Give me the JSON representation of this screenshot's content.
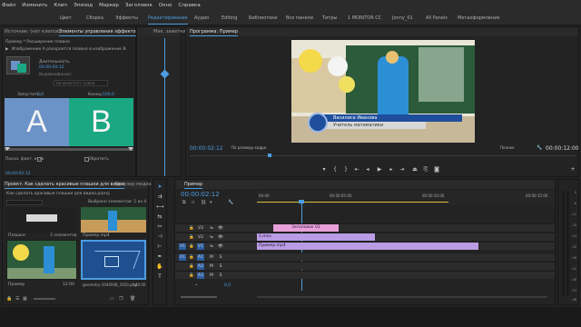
{
  "menu": [
    "Файл",
    "Изменить",
    "Клип",
    "Эпизод",
    "Маркер",
    "Заголовок",
    "Окно",
    "Справка"
  ],
  "workspaces": [
    {
      "label": "Цвет",
      "active": false
    },
    {
      "label": "Сборка",
      "active": false
    },
    {
      "label": "Эффекты",
      "active": false
    },
    {
      "label": "Редактирование",
      "active": true
    },
    {
      "label": "Аудио",
      "active": false
    },
    {
      "label": "Editing",
      "active": false
    },
    {
      "label": "Библиотеки",
      "active": false
    },
    {
      "label": "Все панели",
      "active": false
    },
    {
      "label": "Титры",
      "active": false
    },
    {
      "label": "1 MONITOR CC",
      "active": false
    },
    {
      "label": "Jonny_01",
      "active": false
    },
    {
      "label": "All Panels",
      "active": false
    },
    {
      "label": "Метаоформление",
      "active": false
    }
  ],
  "effects_panel": {
    "tabs": [
      "Источник: (нет клипов)",
      "Элементы управления эффектом",
      "Мик. заметки"
    ],
    "header": "Пример * Расширение плавно",
    "description": "Изображение A раскроется плавно в изображение B.",
    "duration_label": "Длительность",
    "duration_value": "00:00:00:12",
    "alignment_label": "Выравнивание:",
    "alignment_value": "Начинается с клипа",
    "start_label": "Запустить:",
    "start_value": "0,0",
    "end_label": "Конец:",
    "end_value": "100,0",
    "tile_a": "A",
    "tile_b": "B",
    "show_actual": "Показ. факт. исто",
    "reverse": "Обратить",
    "timecode": "00:00:02:12"
  },
  "program_monitor": {
    "title": "Программа: Пример",
    "lower_third_name": "Василиса Иванова",
    "lower_third_role": "Учитель математики",
    "timecode_left": "00:00:02:12",
    "fit": "По размеру кадра",
    "quality": "Полное",
    "timecode_right": "00:00:12:00"
  },
  "project_panel": {
    "tabs": [
      "Проект: Как сделать красивые плашки для видео",
      "Браузер медиа"
    ],
    "file": "Как сделать красивые плашки для видео.prproj",
    "selected": "Выбрано элементов: 1 из 4",
    "items": [
      {
        "name": "Плашки",
        "meta": "3 элементов"
      },
      {
        "name": "Пример.mp4",
        "meta": ""
      },
      {
        "name": "Пример",
        "meta": "12:00"
      },
      {
        "name": "geometry-1044048_1920.png",
        "meta": "1:40:00"
      }
    ]
  },
  "timeline": {
    "tab": "Пример",
    "timecode": "00:00:02:12",
    "ruler": [
      "00:00",
      "00:00:05:00",
      "00:00:10:00",
      "00:00:15:00"
    ],
    "track_labels": [
      "V3",
      "V2",
      "V1",
      "A1",
      "A2",
      "A3"
    ],
    "source_patch": [
      "V1",
      "A1"
    ],
    "clips": [
      {
        "label": "Заголовок 01",
        "track": "V3",
        "color": "#e7a0d8"
      },
      {
        "label": "1.mov",
        "track": "V2",
        "color": "#b99ce3"
      },
      {
        "label": "Пример.mp4",
        "track": "V1",
        "color": "#b99ce3"
      }
    ],
    "master_value": "0,0"
  },
  "vu_meter": {
    "ticks": [
      "0",
      "-6",
      "-12",
      "-18",
      "-24",
      "-30",
      "-36",
      "-42",
      "-48",
      "-54"
    ],
    "unit": "dB"
  },
  "colors": {
    "accent": "#4d9de0",
    "tile_a": "#6c93c8",
    "tile_b": "#1aa782",
    "clip_title": "#e7a0d8",
    "clip_video": "#b99ce3",
    "lower_third": "#1e4e9c"
  }
}
